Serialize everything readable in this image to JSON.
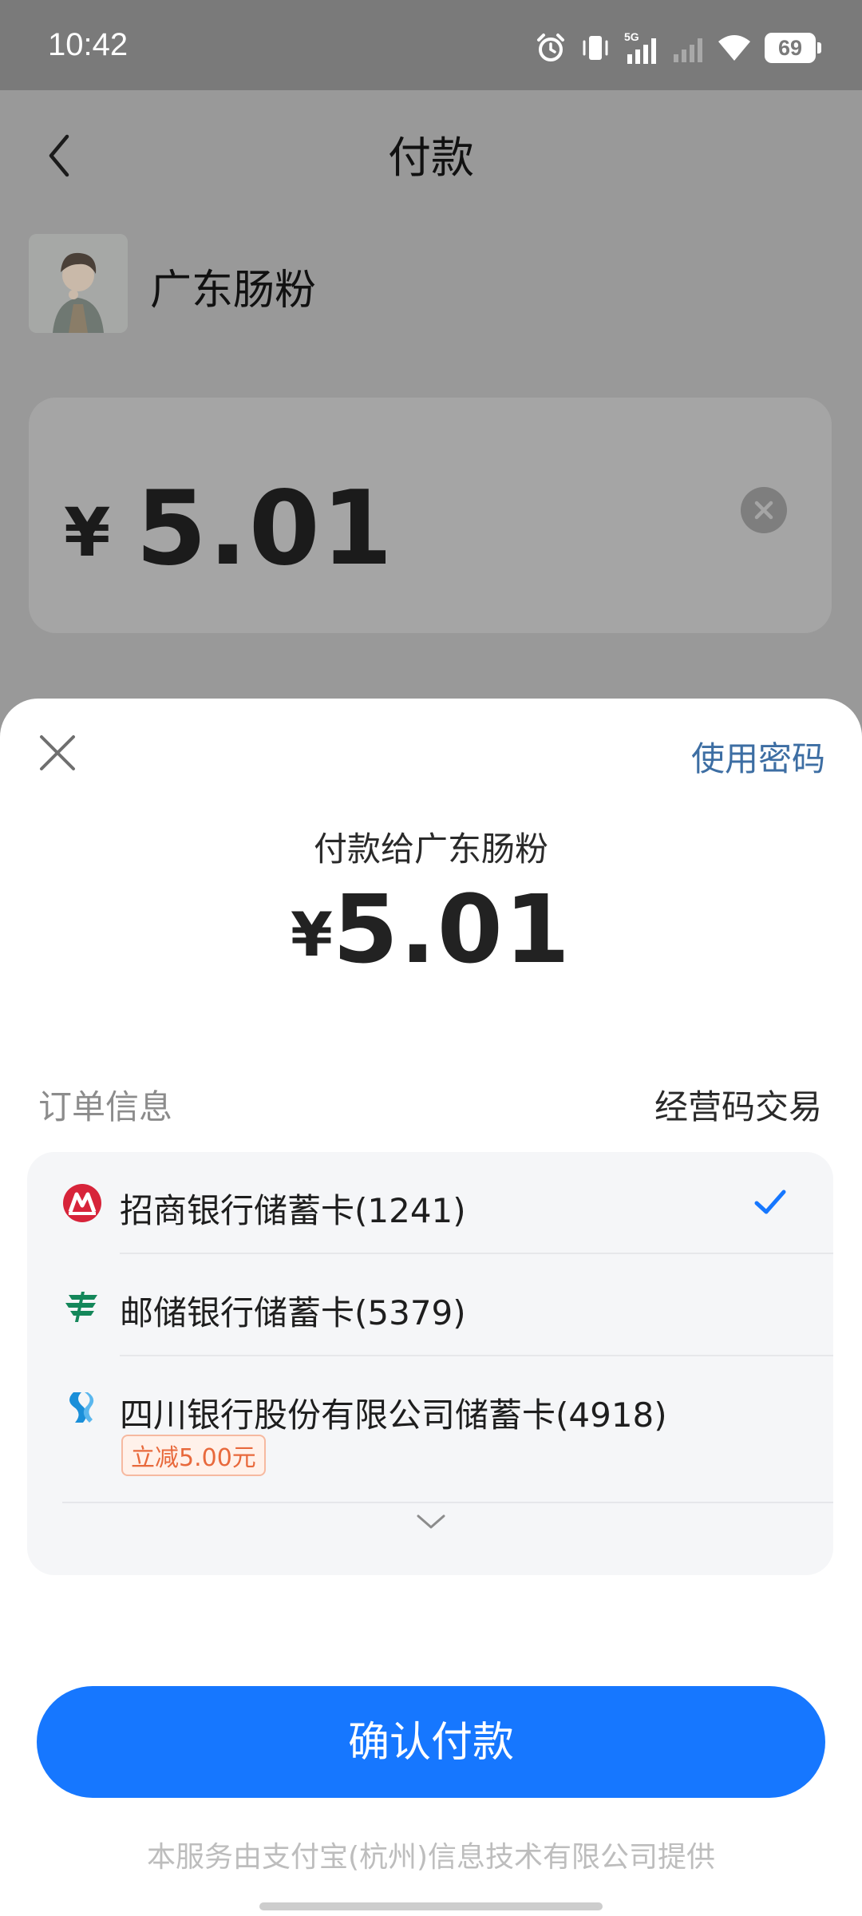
{
  "status_bar": {
    "time": "10:42",
    "network": "5G",
    "battery": "69",
    "icons": [
      "alarm-icon",
      "vibrate-icon",
      "signal-5g-icon",
      "signal-icon",
      "wifi-icon",
      "battery-icon"
    ]
  },
  "page": {
    "title": "付款",
    "merchant_name": "广东肠粉",
    "currency_symbol": "¥",
    "amount": "5.01"
  },
  "sheet": {
    "use_password": "使用密码",
    "pay_to": "付款给广东肠粉",
    "currency_symbol": "¥",
    "amount": "5.01",
    "order_info_label": "订单信息",
    "order_type": "经营码交易",
    "payment_methods": [
      {
        "name": "招商银行储蓄卡(1241)",
        "icon": "cmb-bank-icon",
        "selected": true
      },
      {
        "name": "邮储银行储蓄卡(5379)",
        "icon": "psbc-bank-icon",
        "selected": false
      },
      {
        "name": "四川银行股份有限公司储蓄卡(4918)",
        "icon": "sichuan-bank-icon",
        "selected": false,
        "badge": "立减5.00元"
      }
    ],
    "confirm_label": "确认付款",
    "footer_note": "本服务由支付宝(杭州)信息技术有限公司提供"
  },
  "colors": {
    "primary": "#1677ff",
    "link": "#3d6ea3",
    "check": "#1677ff",
    "promo": "#e8693c"
  }
}
